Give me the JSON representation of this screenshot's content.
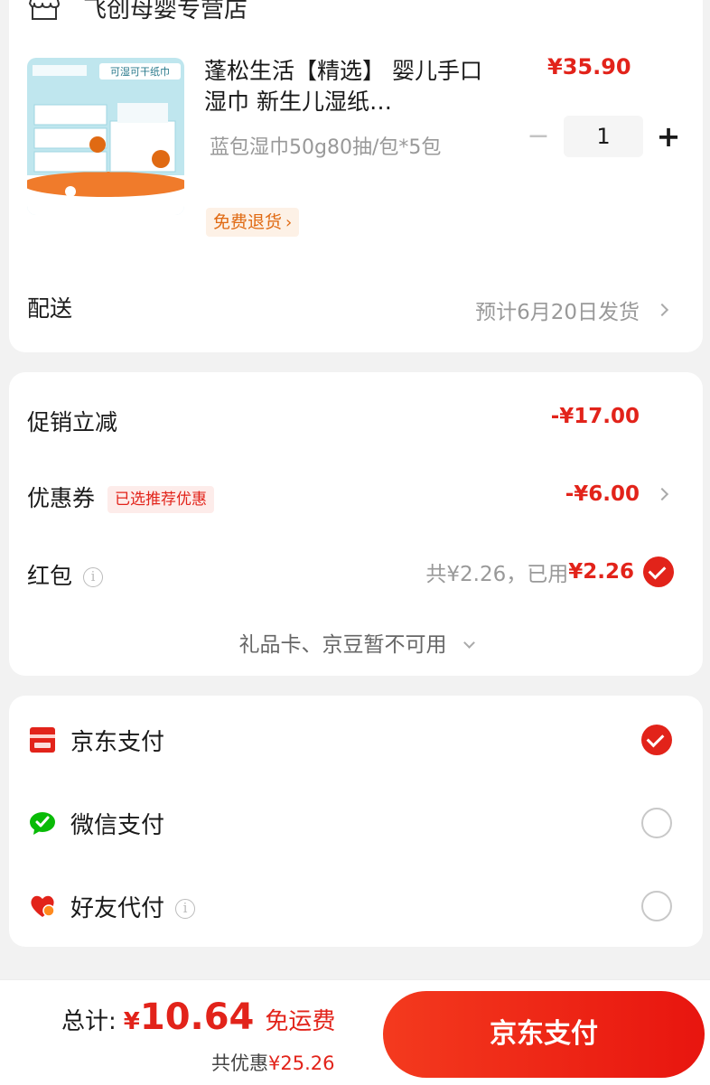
{
  "store": {
    "name": "飞创母婴专营店"
  },
  "product": {
    "title": "蓬松生活【精选】 婴儿手口湿巾 新生儿湿纸…",
    "spec": "蓝包湿巾50g80抽/包*5包",
    "return_tag": "免费退货",
    "price": "¥35.90",
    "quantity": "1",
    "image_banner": "可湿可干纸巾"
  },
  "delivery": {
    "label": "配送",
    "value": "预计6月20日发货"
  },
  "discounts": {
    "promo_label": "促销立减",
    "promo_value": "-¥17.00",
    "coupon_label": "优惠券",
    "coupon_tag": "已选推荐优惠",
    "coupon_value": "-¥6.00",
    "redpacket_label": "红包",
    "redpacket_total": "共¥2.26，已用",
    "redpacket_used": "¥2.26",
    "gift_card_text": "礼品卡、京豆暂不可用"
  },
  "payment": {
    "methods": [
      {
        "label": "京东支付",
        "selected": true
      },
      {
        "label": "微信支付",
        "selected": false
      },
      {
        "label": "好友代付",
        "selected": false
      }
    ]
  },
  "footer": {
    "total_label": "总计:",
    "currency": "¥",
    "total_amount": "10.64",
    "free_shipping": "免运费",
    "saving_prefix": "共优惠",
    "saving_amount": "¥25.26",
    "pay_button": "京东支付"
  },
  "colors": {
    "accent": "#e2231a",
    "wechat": "#09bb07",
    "return_tag": "#e06a13"
  },
  "icons": {
    "store": "store-icon",
    "jd_pay": "jd-pay-icon",
    "wechat": "wechat-icon",
    "friend_pay": "heart-icon",
    "info": "info-icon"
  }
}
